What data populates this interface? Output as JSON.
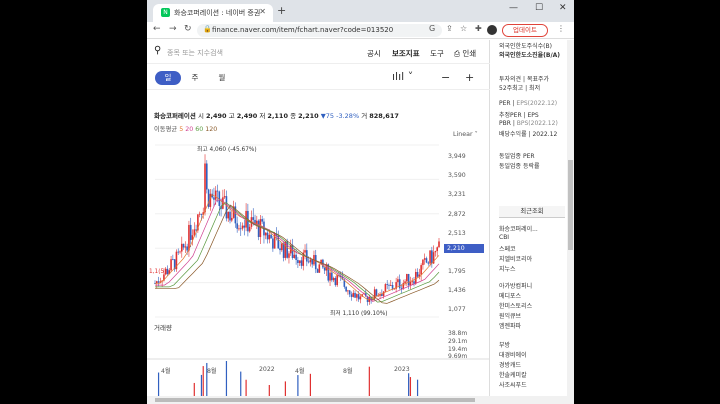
{
  "browser": {
    "tab_title": "화승코퍼레이션 : 네이버 증권",
    "favicon": "N",
    "url": "finance.naver.com/item/fchart.naver?code=013520",
    "update_label": "업데이트"
  },
  "chart_page": {
    "search_placeholder": "종목 또는 지수검색",
    "menu": [
      "공시",
      "보조지표",
      "도구",
      "인쇄"
    ],
    "periods": [
      "일",
      "주",
      "월"
    ],
    "stock_name": "화승코퍼레이션",
    "ohlc": {
      "open_label": "시",
      "open": "2,490",
      "high_label": "고",
      "high": "2,490",
      "low_label": "저",
      "low": "2,110",
      "close_label": "종",
      "close": "2,210",
      "change": "▼75",
      "change_pct": "-3.28%",
      "volume_label": "거",
      "volume": "828,617"
    },
    "ma_label": "이동평균",
    "ma_periods": [
      "5",
      "20",
      "60",
      "120"
    ],
    "scale_label": "Linear",
    "current_price": "2,210",
    "high_annotation": "최고 4,060 (-45.67%)",
    "low_annotation": "최저 1,110 (99.10%)",
    "left_annotation": "1,1(5)",
    "volume_label": "거래량",
    "x_labels": [
      "4월",
      "8월",
      "2022",
      "4월",
      "8월",
      "2023"
    ],
    "price_ticks": [
      "3,949",
      "3,590",
      "3,231",
      "2,872",
      "2,513",
      "1,795",
      "1,436",
      "1,077"
    ],
    "volume_ticks": [
      "38.8m",
      "29.1m",
      "19.4m",
      "9.69m"
    ]
  },
  "side_panel": {
    "items_top": [
      "외국인한도주식수(B)",
      "외국인한도소진율(B/A)"
    ],
    "investment": [
      "투자의견",
      "목표주가",
      "52주최고",
      "최저"
    ],
    "per_rows": [
      "PER",
      "EPS(2022.12)",
      "추정PER",
      "EPS",
      "PBR",
      "BPS(2022.12)",
      "배당수익률",
      "2022.12"
    ],
    "industry": [
      "동일업종 PER",
      "동일업종 등락률"
    ],
    "recent_title": "최근조회",
    "recent": [
      "화승코퍼레이...",
      "CBI",
      "스페코",
      "지엘비코리아",
      "지누스"
    ],
    "recent2": [
      "아가방컴퍼니",
      "메디포스",
      "한미스토리스",
      "원익큐브",
      "엠젠파파"
    ],
    "recent3": [
      "부방",
      "대경비에이",
      "경방캐드",
      "한솔케미칼",
      "사조씨푸드"
    ]
  },
  "chart_data": {
    "type": "line",
    "title": "화승코퍼레이션",
    "x": [
      "2021-04",
      "2021-06",
      "2021-08",
      "2021-10",
      "2021-12",
      "2022-02",
      "2022-04",
      "2022-06",
      "2022-08",
      "2022-10",
      "2022-12",
      "2023-02"
    ],
    "series": [
      {
        "name": "종가",
        "values": [
          1600,
          2100,
          3200,
          2800,
          2600,
          2200,
          2000,
          1700,
          1300,
          1500,
          1700,
          2210
        ]
      }
    ],
    "ylim": [
      1000,
      4060
    ],
    "high": 4060,
    "low": 1110,
    "colors": {
      "up": "#e03030",
      "down": "#3060c0",
      "accent": "#3e5ec5"
    }
  }
}
